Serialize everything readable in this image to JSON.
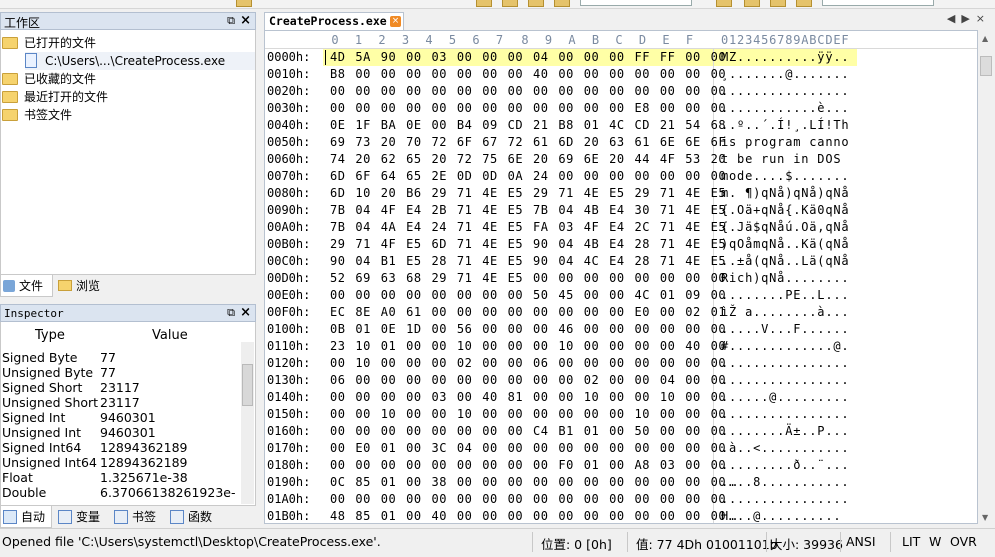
{
  "workspace": {
    "title": "工作区",
    "tree": [
      {
        "label": "已打开的文件",
        "kind": "folder",
        "indent": 0
      },
      {
        "label": "C:\\Users\\...\\CreateProcess.exe",
        "kind": "doc",
        "indent": 1
      },
      {
        "label": "已收藏的文件",
        "kind": "folder",
        "indent": 0
      },
      {
        "label": "最近打开的文件",
        "kind": "folder",
        "indent": 0
      },
      {
        "label": "书签文件",
        "kind": "folder",
        "indent": 0
      }
    ],
    "tabs": [
      "文件",
      "浏览"
    ]
  },
  "inspector": {
    "title": "Inspector",
    "col_type": "Type",
    "col_value": "Value",
    "rows": [
      {
        "type": "Signed Byte",
        "value": "77"
      },
      {
        "type": "Unsigned Byte",
        "value": "77"
      },
      {
        "type": "Signed Short",
        "value": "23117"
      },
      {
        "type": "Unsigned Short",
        "value": "23117"
      },
      {
        "type": "Signed Int",
        "value": "9460301"
      },
      {
        "type": "Unsigned Int",
        "value": "9460301"
      },
      {
        "type": "Signed Int64",
        "value": "12894362189"
      },
      {
        "type": "Unsigned Int64",
        "value": "12894362189"
      },
      {
        "type": "Float",
        "value": "1.325671e-38"
      },
      {
        "type": "Double",
        "value": "6.37066138261923e-..."
      }
    ],
    "tabs": [
      "自动",
      "变量",
      "书签",
      "函数"
    ]
  },
  "editor": {
    "file_tab": "CreateProcess.exe",
    "col_headers": [
      "0",
      "1",
      "2",
      "3",
      "4",
      "5",
      "6",
      "7",
      "8",
      "9",
      "A",
      "B",
      "C",
      "D",
      "E",
      "F"
    ],
    "ascii_header": "0123456789ABCDEF",
    "rows": [
      {
        "off": "0000h:",
        "hex": "4D 5A 90 00 03 00 00 00 04 00 00 00 FF FF 00 00",
        "asc": "MZ..........ÿÿ.."
      },
      {
        "off": "0010h:",
        "hex": "B8 00 00 00 00 00 00 00 40 00 00 00 00 00 00 00",
        "asc": "¸.......@......."
      },
      {
        "off": "0020h:",
        "hex": "00 00 00 00 00 00 00 00 00 00 00 00 00 00 00 00",
        "asc": "................"
      },
      {
        "off": "0030h:",
        "hex": "00 00 00 00 00 00 00 00 00 00 00 00 E8 00 00 00",
        "asc": "............è..."
      },
      {
        "off": "0040h:",
        "hex": "0E 1F BA 0E 00 B4 09 CD 21 B8 01 4C CD 21 54 68",
        "asc": "..º..´.Í!¸.LÍ!Th"
      },
      {
        "off": "0050h:",
        "hex": "69 73 20 70 72 6F 67 72 61 6D 20 63 61 6E 6E 6F",
        "asc": "is program canno"
      },
      {
        "off": "0060h:",
        "hex": "74 20 62 65 20 72 75 6E 20 69 6E 20 44 4F 53 20",
        "asc": "t be run in DOS "
      },
      {
        "off": "0070h:",
        "hex": "6D 6F 64 65 2E 0D 0D 0A 24 00 00 00 00 00 00 00",
        "asc": "mode....$......."
      },
      {
        "off": "0080h:",
        "hex": "6D 10 20 B6 29 71 4E E5 29 71 4E E5 29 71 4E E5",
        "asc": "m. ¶)qNå)qNå)qNå"
      },
      {
        "off": "0090h:",
        "hex": "7B 04 4F E4 2B 71 4E E5 7B 04 4B E4 30 71 4E E5",
        "asc": "{.Oä+qNå{.Kä0qNå"
      },
      {
        "off": "00A0h:",
        "hex": "7B 04 4A E4 24 71 4E E5 FA 03 4F E4 2C 71 4E E5",
        "asc": "{.Jä$qNåú.Oä,qNå"
      },
      {
        "off": "00B0h:",
        "hex": "29 71 4F E5 6D 71 4E E5 90 04 4B E4 28 71 4E E5",
        "asc": ")qOåmqNå..Kä(qNå"
      },
      {
        "off": "00C0h:",
        "hex": "90 04 B1 E5 28 71 4E E5 90 04 4C E4 28 71 4E E5",
        "asc": "..±å(qNå..Lä(qNå"
      },
      {
        "off": "00D0h:",
        "hex": "52 69 63 68 29 71 4E E5 00 00 00 00 00 00 00 00",
        "asc": "Rich)qNå........"
      },
      {
        "off": "00E0h:",
        "hex": "00 00 00 00 00 00 00 00 50 45 00 00 4C 01 09 00",
        "asc": "........PE..L..."
      },
      {
        "off": "00F0h:",
        "hex": "EC 8E A0 61 00 00 00 00 00 00 00 00 E0 00 02 01",
        "asc": "ìŽ a........à..."
      },
      {
        "off": "0100h:",
        "hex": "0B 01 0E 1D 00 56 00 00 00 46 00 00 00 00 00 00",
        "asc": ".....V...F......"
      },
      {
        "off": "0110h:",
        "hex": "23 10 01 00 00 10 00 00 00 10 00 00 00 00 40 00",
        "asc": "#.............@."
      },
      {
        "off": "0120h:",
        "hex": "00 10 00 00 00 02 00 00 06 00 00 00 00 00 00 00",
        "asc": "................"
      },
      {
        "off": "0130h:",
        "hex": "06 00 00 00 00 00 00 00 00 00 02 00 00 04 00 00",
        "asc": "................"
      },
      {
        "off": "0140h:",
        "hex": "00 00 00 00 03 00 40 81 00 00 10 00 00 10 00 00",
        "asc": "......@........."
      },
      {
        "off": "0150h:",
        "hex": "00 00 10 00 00 10 00 00 00 00 00 00 10 00 00 00",
        "asc": "................"
      },
      {
        "off": "0160h:",
        "hex": "00 00 00 00 00 00 00 00 C4 B1 01 00 50 00 00 00",
        "asc": "........Ä±..P..."
      },
      {
        "off": "0170h:",
        "hex": "00 E0 01 00 3C 04 00 00 00 00 00 00 00 00 00 00",
        "asc": ".à..<..........."
      },
      {
        "off": "0180h:",
        "hex": "00 00 00 00 00 00 00 00 00 F0 01 00 A8 03 00 00",
        "asc": ".........ð..¨..."
      },
      {
        "off": "0190h:",
        "hex": "0C 85 01 00 38 00 00 00 00 00 00 00 00 00 00 00",
        "asc": ".…..8..........."
      },
      {
        "off": "01A0h:",
        "hex": "00 00 00 00 00 00 00 00 00 00 00 00 00 00 00 00",
        "asc": "................"
      },
      {
        "off": "01B0h:",
        "hex": "48 85 01 00 40 00 00 00 00 00 00 00 00 00 00 00",
        "asc": "H…..@.........."
      }
    ]
  },
  "status": {
    "message": "Opened file 'C:\\Users\\systemctl\\Desktop\\CreateProcess.exe'.",
    "position": "位置: 0 [0h]",
    "value": "值: 77 4Dh 01001101b",
    "size": "大小: 39936",
    "encoding": "ANSI",
    "endian": "LIT",
    "mode1": "W",
    "mode2": "OVR"
  },
  "colors": {
    "selection": "#ffffa6",
    "panel_header": "#dbe4f0",
    "folder": "#f6d36d"
  }
}
